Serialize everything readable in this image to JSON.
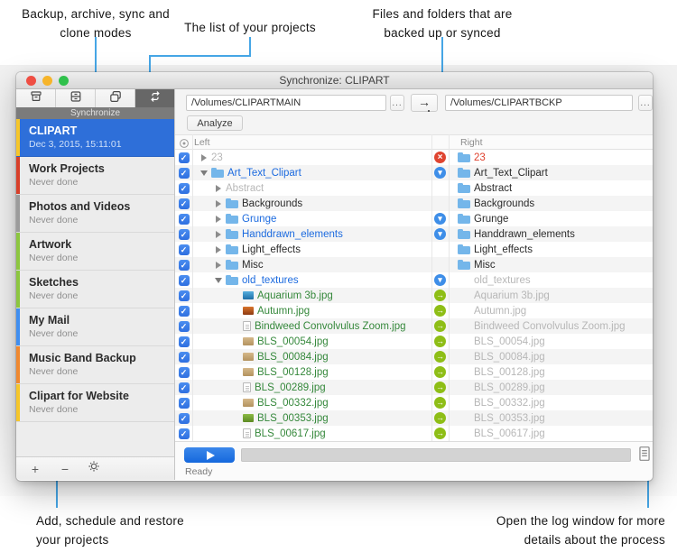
{
  "theme": {
    "annotation_line": "#46a6e6",
    "accent_blue": "#2e6fd9",
    "checkbox_blue": "#3478df",
    "folder_blue": "#74b6ea",
    "status_delete_red": "#df4430",
    "status_update_blue": "#3e8ee8",
    "status_copy_green": "#8ebe16"
  },
  "callouts": {
    "modes": [
      "Backup, archive, sync and",
      "clone modes"
    ],
    "project_list": [
      "The list of your projects"
    ],
    "files": [
      "Files and folders that are",
      "backed up or synced"
    ],
    "add_schedule": [
      "Add, schedule and restore",
      "your projects"
    ],
    "log": [
      "Open the log window for more",
      "details about the process"
    ]
  },
  "window": {
    "title": "Synchronize: CLIPART",
    "traffic_lights": [
      "close",
      "minimize",
      "zoom"
    ],
    "tabs": [
      {
        "id": "backup",
        "icon": "backup-box-icon",
        "selected": false
      },
      {
        "id": "archive",
        "icon": "archive-drawers-icon",
        "selected": false
      },
      {
        "id": "clone",
        "icon": "clone-icon",
        "selected": false
      },
      {
        "id": "synchronize",
        "icon": "sync-icon",
        "selected": true
      }
    ],
    "mode_label": "Synchronize",
    "projects": [
      {
        "name": "CLIPART",
        "status": "Dec 3, 2015, 15:11:01",
        "stripe": "#f6c62a",
        "selected": true
      },
      {
        "name": "Work Projects",
        "status": "Never done",
        "stripe": "#d8402a",
        "selected": false
      },
      {
        "name": "Photos and Videos",
        "status": "Never done",
        "stripe": "#9b9b9b",
        "selected": false
      },
      {
        "name": "Artwork",
        "status": "Never done",
        "stripe": "#8cc63f",
        "selected": false
      },
      {
        "name": "Sketches",
        "status": "Never done",
        "stripe": "#8cc63f",
        "selected": false
      },
      {
        "name": "My Mail",
        "status": "Never done",
        "stripe": "#3f8ef0",
        "selected": false
      },
      {
        "name": "Music Band Backup",
        "status": "Never done",
        "stripe": "#f0882f",
        "selected": false
      },
      {
        "name": "Clipart for Website",
        "status": "Never done",
        "stripe": "#f6c62a",
        "selected": false
      }
    ],
    "sidebar_footer": {
      "add": "+",
      "remove": "−",
      "settings": "gear-icon"
    },
    "paths": {
      "source": "/Volumes/CLIPARTMAIN",
      "destination": "/Volumes/CLIPARTBCKP",
      "browse": "...",
      "direction": "→",
      "analyze": "Analyze"
    },
    "list": {
      "select_all_icon": "circle-dot-icon",
      "left_header": "Left",
      "right_header": "Right",
      "rows": [
        {
          "checked": true,
          "status": "delete",
          "left": {
            "indent": 0,
            "expander": "collapsed",
            "icon": null,
            "name": "23",
            "color": "gray"
          },
          "right": {
            "icon": "folder",
            "name": "23",
            "color": "red"
          }
        },
        {
          "checked": true,
          "status": "update",
          "left": {
            "indent": 0,
            "expander": "expanded",
            "icon": "folder",
            "name": "Art_Text_Clipart",
            "color": "blue"
          },
          "right": {
            "icon": "folder",
            "name": "Art_Text_Clipart",
            "color": "black"
          }
        },
        {
          "checked": true,
          "status": null,
          "left": {
            "indent": 1,
            "expander": "collapsed",
            "icon": null,
            "name": "Abstract",
            "color": "gray"
          },
          "right": {
            "icon": "folder",
            "name": "Abstract",
            "color": "black"
          }
        },
        {
          "checked": true,
          "status": null,
          "left": {
            "indent": 1,
            "expander": "collapsed",
            "icon": "folder",
            "name": "Backgrounds",
            "color": "black"
          },
          "right": {
            "icon": "folder",
            "name": "Backgrounds",
            "color": "black"
          }
        },
        {
          "checked": true,
          "status": "update",
          "left": {
            "indent": 1,
            "expander": "collapsed",
            "icon": "folder",
            "name": "Grunge",
            "color": "blue"
          },
          "right": {
            "icon": "folder",
            "name": "Grunge",
            "color": "black"
          }
        },
        {
          "checked": true,
          "status": "update",
          "left": {
            "indent": 1,
            "expander": "collapsed",
            "icon": "folder",
            "name": "Handdrawn_elements",
            "color": "blue"
          },
          "right": {
            "icon": "folder",
            "name": "Handdrawn_elements",
            "color": "black"
          }
        },
        {
          "checked": true,
          "status": null,
          "left": {
            "indent": 1,
            "expander": "collapsed",
            "icon": "folder",
            "name": "Light_effects",
            "color": "black"
          },
          "right": {
            "icon": "folder",
            "name": "Light_effects",
            "color": "black"
          }
        },
        {
          "checked": true,
          "status": null,
          "left": {
            "indent": 1,
            "expander": "collapsed",
            "icon": "folder",
            "name": "Misc",
            "color": "black"
          },
          "right": {
            "icon": "folder",
            "name": "Misc",
            "color": "black"
          }
        },
        {
          "checked": true,
          "status": "update",
          "left": {
            "indent": 1,
            "expander": "expanded",
            "icon": "folder",
            "name": "old_textures",
            "color": "blue"
          },
          "right": {
            "icon": null,
            "name": "old_textures",
            "color": "gray"
          }
        },
        {
          "checked": true,
          "status": "copy",
          "left": {
            "indent": 2,
            "expander": null,
            "icon": "img-blue",
            "name": "Aquarium 3b.jpg",
            "color": "green"
          },
          "right": {
            "icon": null,
            "name": "Aquarium 3b.jpg",
            "color": "gray"
          }
        },
        {
          "checked": true,
          "status": "copy",
          "left": {
            "indent": 2,
            "expander": null,
            "icon": "img-orange",
            "name": "Autumn.jpg",
            "color": "green"
          },
          "right": {
            "icon": null,
            "name": "Autumn.jpg",
            "color": "gray"
          }
        },
        {
          "checked": true,
          "status": "copy",
          "left": {
            "indent": 2,
            "expander": null,
            "icon": "doc",
            "name": "Bindweed Convolvulus Zoom.jpg",
            "color": "green"
          },
          "right": {
            "icon": null,
            "name": "Bindweed Convolvulus Zoom.jpg",
            "color": "gray"
          }
        },
        {
          "checked": true,
          "status": "copy",
          "left": {
            "indent": 2,
            "expander": null,
            "icon": "img-tan",
            "name": "BLS_00054.jpg",
            "color": "green"
          },
          "right": {
            "icon": null,
            "name": "BLS_00054.jpg",
            "color": "gray"
          }
        },
        {
          "checked": true,
          "status": "copy",
          "left": {
            "indent": 2,
            "expander": null,
            "icon": "img-tan",
            "name": "BLS_00084.jpg",
            "color": "green"
          },
          "right": {
            "icon": null,
            "name": "BLS_00084.jpg",
            "color": "gray"
          }
        },
        {
          "checked": true,
          "status": "copy",
          "left": {
            "indent": 2,
            "expander": null,
            "icon": "img-tan",
            "name": "BLS_00128.jpg",
            "color": "green"
          },
          "right": {
            "icon": null,
            "name": "BLS_00128.jpg",
            "color": "gray"
          }
        },
        {
          "checked": true,
          "status": "copy",
          "left": {
            "indent": 2,
            "expander": null,
            "icon": "doc",
            "name": "BLS_00289.jpg",
            "color": "green"
          },
          "right": {
            "icon": null,
            "name": "BLS_00289.jpg",
            "color": "gray"
          }
        },
        {
          "checked": true,
          "status": "copy",
          "left": {
            "indent": 2,
            "expander": null,
            "icon": "img-tan",
            "name": "BLS_00332.jpg",
            "color": "green"
          },
          "right": {
            "icon": null,
            "name": "BLS_00332.jpg",
            "color": "gray"
          }
        },
        {
          "checked": true,
          "status": "copy",
          "left": {
            "indent": 2,
            "expander": null,
            "icon": "img-green",
            "name": "BLS_00353.jpg",
            "color": "green"
          },
          "right": {
            "icon": null,
            "name": "BLS_00353.jpg",
            "color": "gray"
          }
        },
        {
          "checked": true,
          "status": "copy",
          "left": {
            "indent": 2,
            "expander": null,
            "icon": "doc",
            "name": "BLS_00617.jpg",
            "color": "green"
          },
          "right": {
            "icon": null,
            "name": "BLS_00617.jpg",
            "color": "gray"
          }
        }
      ]
    },
    "footer": {
      "run_icon": "play-icon",
      "status": "Ready",
      "log_icon": "log-icon"
    }
  }
}
